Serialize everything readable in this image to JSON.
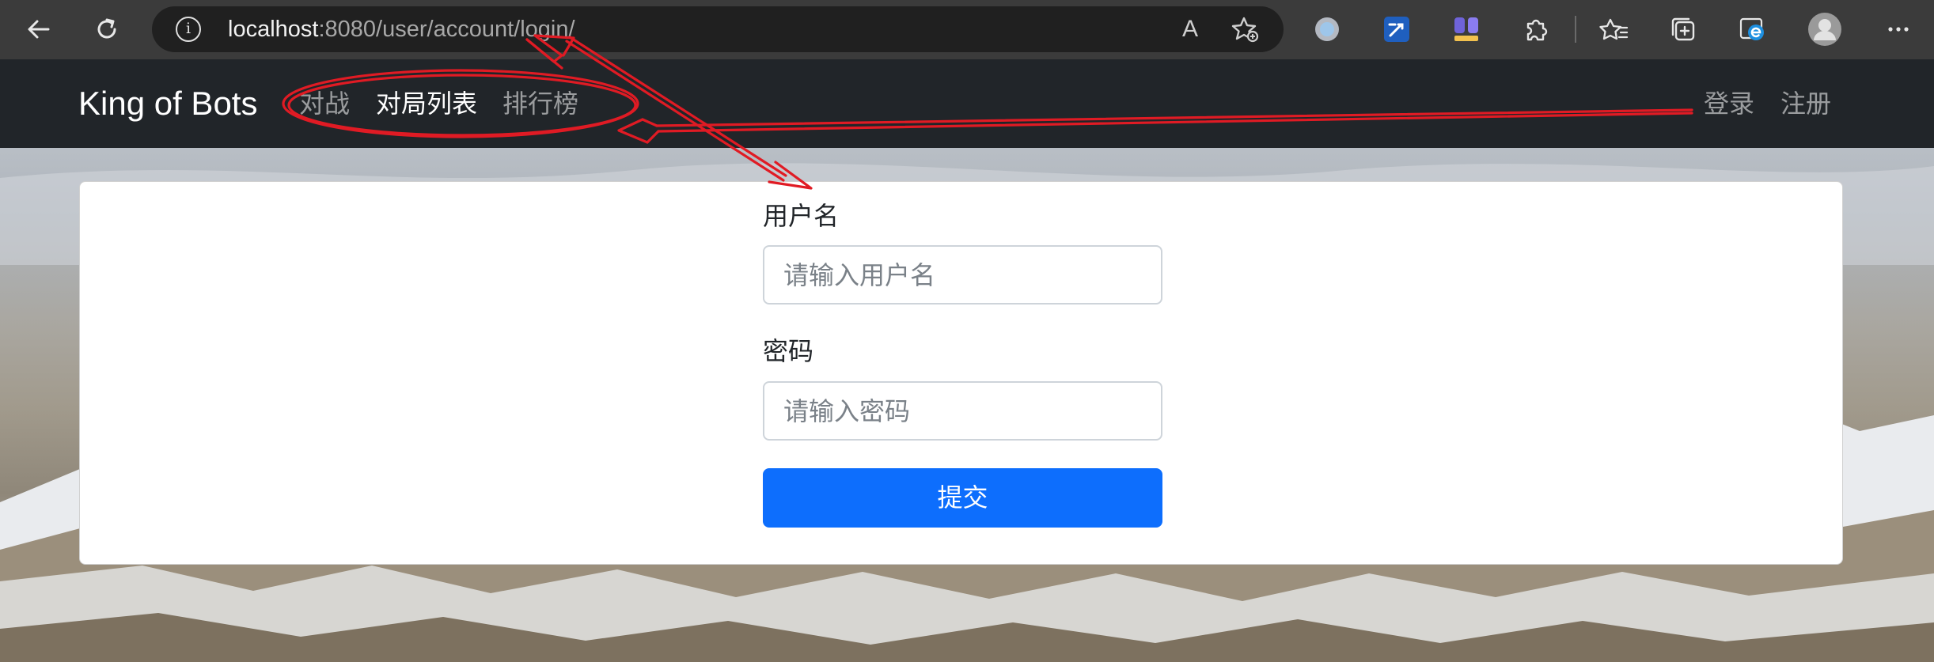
{
  "browser": {
    "url_host": "localhost",
    "url_rest": ":8080/user/account/login/",
    "read_aloud_glyph": "A",
    "info_glyph": "i",
    "more_glyph": "···"
  },
  "navbar": {
    "brand": "King of Bots",
    "links": [
      {
        "label": "对战",
        "active": false
      },
      {
        "label": "对局列表",
        "active": true
      },
      {
        "label": "排行榜",
        "active": false
      }
    ],
    "right_links": [
      {
        "label": "登录"
      },
      {
        "label": "注册"
      }
    ]
  },
  "login_form": {
    "username_label": "用户名",
    "username_placeholder": "请输入用户名",
    "username_value": "",
    "password_label": "密码",
    "password_placeholder": "请输入密码",
    "password_value": "",
    "submit_label": "提交"
  },
  "colors": {
    "navbar_bg": "#212529",
    "primary": "#0d6efd",
    "annotation": "#e01b24",
    "browser_bg": "#3b3b3b"
  },
  "icons": [
    "back-arrow-icon",
    "refresh-icon",
    "site-info-icon",
    "read-aloud-icon",
    "add-favorite-icon",
    "extension-circle-icon",
    "extension-edit-icon",
    "extension-avatar-icon",
    "extensions-puzzle-icon",
    "favorites-icon",
    "collections-icon",
    "ie-mode-icon",
    "profile-avatar-icon",
    "more-options-icon"
  ]
}
